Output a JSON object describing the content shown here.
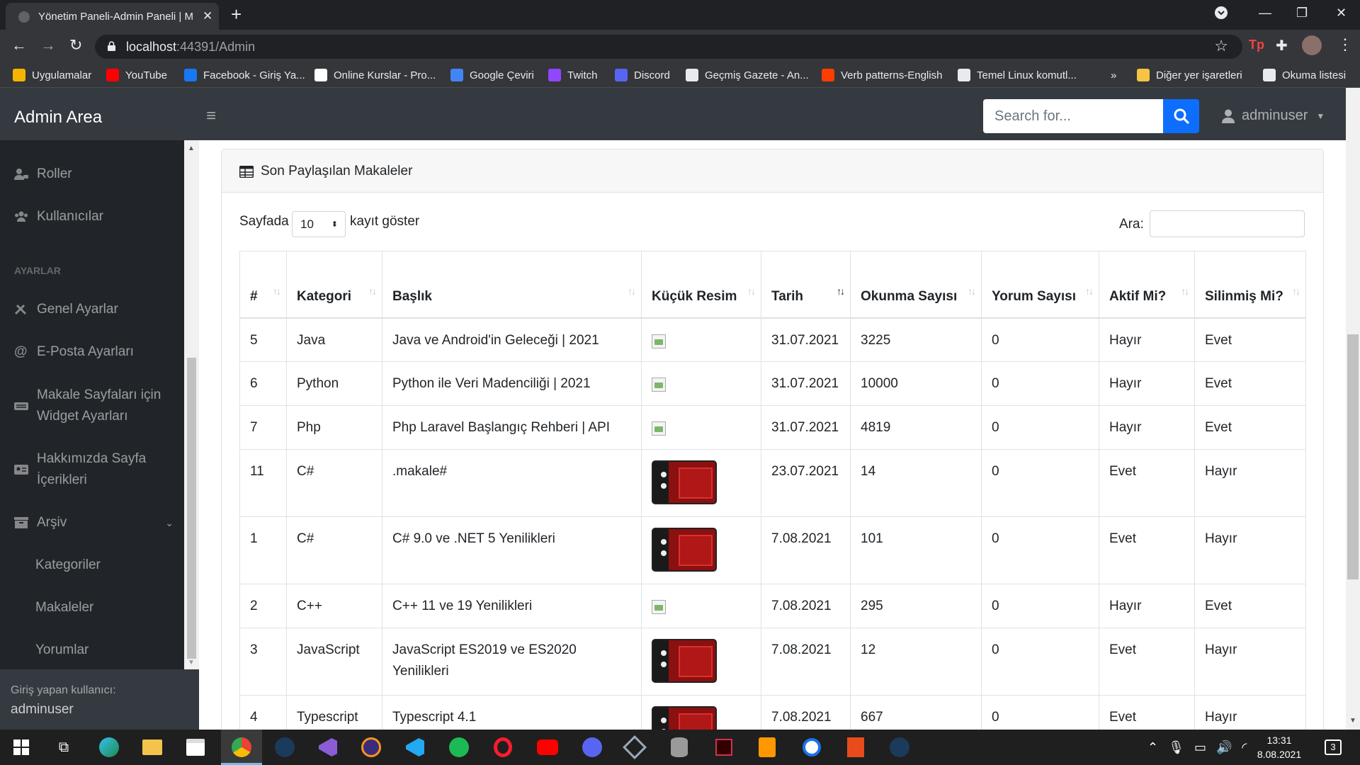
{
  "browser": {
    "tab_title": "Yönetim Paneli-Admin Paneli | M",
    "url_host": "localhost",
    "url_rest": ":44391/Admin",
    "bookmarks": [
      {
        "label": "Uygulamalar",
        "color": "#f4b400"
      },
      {
        "label": "YouTube",
        "color": "#ff0000"
      },
      {
        "label": "Facebook - Giriş Ya...",
        "color": "#1877f2"
      },
      {
        "label": "Online Kurslar - Pro...",
        "color": "#ffffff"
      },
      {
        "label": "Google Çeviri",
        "color": "#4285f4"
      },
      {
        "label": "Twitch",
        "color": "#9146ff"
      },
      {
        "label": "Discord",
        "color": "#5865f2"
      },
      {
        "label": "Geçmiş Gazete - An...",
        "color": "#e8eaed"
      },
      {
        "label": "Verb patterns-English",
        "color": "#ff3d00"
      },
      {
        "label": "Temel Linux komutl...",
        "color": "#e8eaed"
      },
      {
        "label": "»",
        "color": ""
      },
      {
        "label": "Diğer yer işaretleri",
        "color": "#f6c344"
      },
      {
        "label": "Okuma listesi",
        "color": "#e8eaed"
      }
    ]
  },
  "topnav": {
    "brand": "Admin Area",
    "search_placeholder": "Search for...",
    "username": "adminuser"
  },
  "sidebar": {
    "items": [
      {
        "label": "Roller",
        "icon": "user-tag-icon"
      },
      {
        "label": "Kullanıcılar",
        "icon": "users-icon"
      }
    ],
    "section_heading": "AYARLAR",
    "settings": [
      {
        "label": "Genel Ayarlar",
        "icon": "tools-icon"
      },
      {
        "label": "E-Posta Ayarları",
        "icon": "at-icon"
      },
      {
        "label": "Makale Sayfaları için Widget Ayarları",
        "icon": "keyboard-icon"
      },
      {
        "label": "Hakkımızda Sayfa İçerikleri",
        "icon": "id-card-icon"
      },
      {
        "label": "Arşiv",
        "icon": "archive-icon"
      }
    ],
    "archive_children": [
      "Kategoriler",
      "Makaleler",
      "Yorumlar"
    ],
    "footer_label": "Giriş yapan kullanıcı:",
    "footer_user": "adminuser"
  },
  "card": {
    "title": "Son Paylaşılan Makaleler",
    "length_prefix": "Sayfada",
    "length_value": "10",
    "length_suffix": "kayıt göster",
    "search_label": "Ara:"
  },
  "table": {
    "columns": [
      "#",
      "Kategori",
      "Başlık",
      "Küçük Resim",
      "Tarih",
      "Okunma Sayısı",
      "Yorum Sayısı",
      "Aktif Mi?",
      "Silinmiş Mi?"
    ],
    "rows": [
      {
        "id": "5",
        "category": "Java",
        "title": "Java ve Android'in Geleceği | 2021",
        "thumb": "broken",
        "date": "31.07.2021",
        "views": "3225",
        "comments": "0",
        "active": "Hayır",
        "deleted": "Evet"
      },
      {
        "id": "6",
        "category": "Python",
        "title": "Python ile Veri Madenciliği | 2021",
        "thumb": "broken",
        "date": "31.07.2021",
        "views": "10000",
        "comments": "0",
        "active": "Hayır",
        "deleted": "Evet"
      },
      {
        "id": "7",
        "category": "Php",
        "title": "Php Laravel Başlangıç Rehberi | API",
        "thumb": "broken",
        "date": "31.07.2021",
        "views": "4819",
        "comments": "0",
        "active": "Hayır",
        "deleted": "Evet"
      },
      {
        "id": "11",
        "category": "C#",
        "title": ".makale#",
        "thumb": "image",
        "date": "23.07.2021",
        "views": "14",
        "comments": "0",
        "active": "Evet",
        "deleted": "Hayır"
      },
      {
        "id": "1",
        "category": "C#",
        "title": "C# 9.0 ve .NET 5 Yenilikleri",
        "thumb": "image",
        "date": "7.08.2021",
        "views": "101",
        "comments": "0",
        "active": "Evet",
        "deleted": "Hayır"
      },
      {
        "id": "2",
        "category": "C++",
        "title": "C++ 11 ve 19 Yenilikleri",
        "thumb": "broken",
        "date": "7.08.2021",
        "views": "295",
        "comments": "0",
        "active": "Hayır",
        "deleted": "Evet"
      },
      {
        "id": "3",
        "category": "JavaScript",
        "title": "JavaScript ES2019 ve ES2020 Yenilikleri",
        "thumb": "image",
        "date": "7.08.2021",
        "views": "12",
        "comments": "0",
        "active": "Evet",
        "deleted": "Hayır"
      },
      {
        "id": "4",
        "category": "Typescript",
        "title": "Typescript 4.1",
        "thumb": "image",
        "date": "7.08.2021",
        "views": "667",
        "comments": "0",
        "active": "Evet",
        "deleted": "Hayır"
      }
    ]
  },
  "taskbar": {
    "time": "13:31",
    "date": "8.08.2021",
    "notifications": "3"
  }
}
